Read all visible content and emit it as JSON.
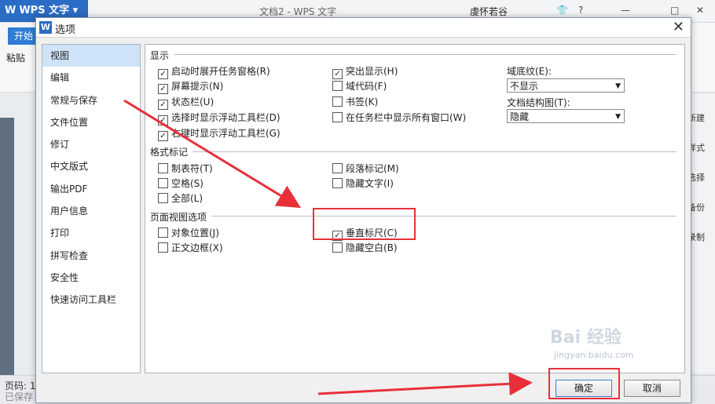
{
  "app": {
    "logo": "WPS 文字",
    "doc_title": "文档2 - WPS 文字",
    "user": "虔怀若谷",
    "start_tab": "开始",
    "paste": "粘贴",
    "status": "页码: 1",
    "status2": "已保存",
    "right_tools": [
      "新建",
      "样式",
      "选择",
      "备份",
      "录制"
    ]
  },
  "dialog": {
    "title": "选项",
    "nav": [
      "视图",
      "编辑",
      "常规与保存",
      "文件位置",
      "修订",
      "中文版式",
      "输出PDF",
      "用户信息",
      "打印",
      "拼写检查",
      "安全性",
      "快速访问工具栏"
    ],
    "selected_nav": "视图",
    "sections": {
      "display": {
        "title": "显示",
        "col1": [
          {
            "label": "启动时展开任务窗格(R)",
            "checked": true
          },
          {
            "label": "屏幕提示(N)",
            "checked": true
          },
          {
            "label": "状态栏(U)",
            "checked": true
          },
          {
            "label": "选择时显示浮动工具栏(D)",
            "checked": true
          },
          {
            "label": "右键时显示浮动工具栏(G)",
            "checked": true
          }
        ],
        "col2": [
          {
            "label": "突出显示(H)",
            "checked": true
          },
          {
            "label": "域代码(F)",
            "checked": false
          },
          {
            "label": "书签(K)",
            "checked": false
          },
          {
            "label": "在任务栏中显示所有窗口(W)",
            "checked": false
          }
        ],
        "field_shading_label": "域底纹(E):",
        "field_shading_value": "不显示",
        "doc_map_label": "文档结构图(T):",
        "doc_map_value": "隐藏"
      },
      "format_marks": {
        "title": "格式标记",
        "col1": [
          {
            "label": "制表符(T)",
            "checked": false
          },
          {
            "label": "空格(S)",
            "checked": false
          },
          {
            "label": "全部(L)",
            "checked": false
          }
        ],
        "col2": [
          {
            "label": "段落标记(M)",
            "checked": false
          },
          {
            "label": "隐藏文字(I)",
            "checked": false
          }
        ]
      },
      "page_view": {
        "title": "页面视图选项",
        "col1": [
          {
            "label": "对象位置(J)",
            "checked": false
          },
          {
            "label": "正文边框(X)",
            "checked": false
          }
        ],
        "col2": [
          {
            "label": "垂直标尺(C)",
            "checked": true
          },
          {
            "label": "隐藏空白(B)",
            "checked": false
          }
        ]
      }
    },
    "ok_label": "确定",
    "cancel_label": "取消"
  },
  "annotations": {
    "highlight_color": "#e8303a",
    "watermark": "Bai 经验",
    "watermark_url": "jingyan.baidu.com"
  }
}
